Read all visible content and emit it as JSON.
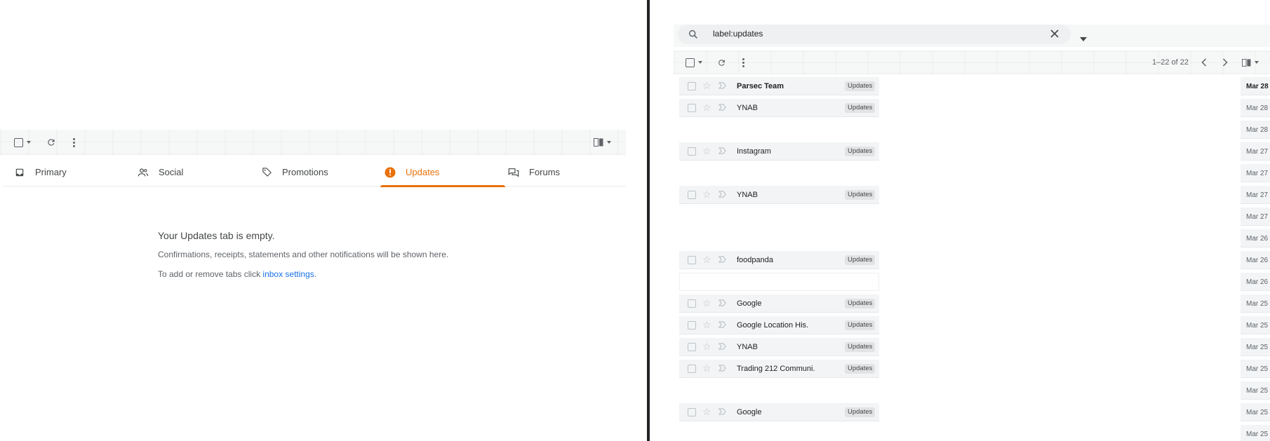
{
  "left": {
    "tabs": [
      {
        "label": "Primary",
        "icon": "inbox-icon"
      },
      {
        "label": "Social",
        "icon": "people-icon"
      },
      {
        "label": "Promotions",
        "icon": "tag-icon"
      },
      {
        "label": "Updates",
        "icon": "info-icon",
        "active": true
      },
      {
        "label": "Forums",
        "icon": "forum-icon"
      }
    ],
    "empty_title": "Your Updates tab is empty.",
    "empty_desc": "Confirmations, receipts, statements and other notifications will be shown here.",
    "empty_hint_prefix": "To add or remove tabs click ",
    "empty_hint_link": "inbox settings",
    "empty_hint_suffix": "."
  },
  "right": {
    "search_value": "label:updates",
    "pagination": "1–22 of 22",
    "emails": [
      {
        "sender": "Parsec Team",
        "label": "Updates",
        "date": "Mar 28",
        "unread": true
      },
      {
        "sender": "YNAB",
        "label": "Updates",
        "date": "Mar 28"
      },
      {
        "sender": "",
        "label": "",
        "date": "Mar 28"
      },
      {
        "sender": "Instagram",
        "label": "Updates",
        "date": "Mar 27"
      },
      {
        "sender": "",
        "label": "",
        "date": "Mar 27"
      },
      {
        "sender": "YNAB",
        "label": "Updates",
        "date": "Mar 27"
      },
      {
        "sender": "",
        "label": "",
        "date": "Mar 27"
      },
      {
        "sender": "",
        "label": "",
        "date": "Mar 26"
      },
      {
        "sender": "foodpanda",
        "label": "Updates",
        "date": "Mar 26"
      },
      {
        "sender": "",
        "label": "",
        "date": "Mar 26"
      },
      {
        "sender": "Google",
        "label": "Updates",
        "date": "Mar 25"
      },
      {
        "sender": "Google Location His.",
        "label": "Updates",
        "date": "Mar 25"
      },
      {
        "sender": "YNAB",
        "label": "Updates",
        "date": "Mar 25"
      },
      {
        "sender": "Trading 212 Communi.",
        "label": "Updates",
        "date": "Mar 25"
      },
      {
        "sender": "",
        "label": "",
        "date": "Mar 25"
      },
      {
        "sender": "Google",
        "label": "Updates",
        "date": "Mar 25"
      },
      {
        "sender": "",
        "label": "",
        "date": "Mar 25"
      }
    ]
  },
  "colors": {
    "accent": "#e8710a",
    "link": "#1a73e8"
  }
}
